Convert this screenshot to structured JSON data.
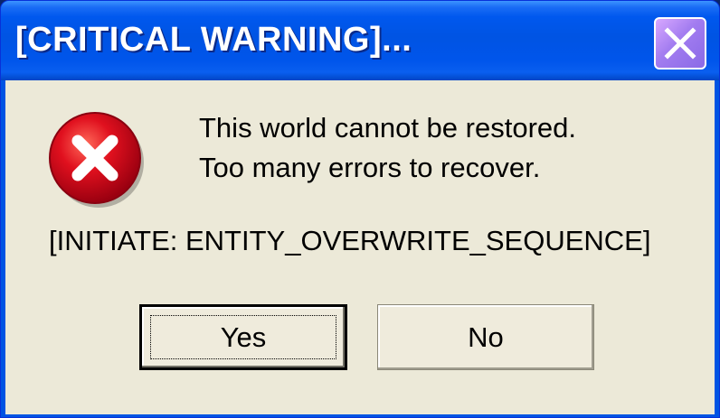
{
  "window": {
    "title": "[CRITICAL WARNING]...",
    "close_icon": "close-x-icon"
  },
  "dialog": {
    "icon": "error-icon",
    "message_line_1": "This world cannot be restored.",
    "message_line_2": "Too many errors to recover.",
    "command": "[INITIATE: ENTITY_OVERWRITE_SEQUENCE]"
  },
  "buttons": {
    "yes_label": "Yes",
    "no_label": "No"
  },
  "colors": {
    "titlebar": "#0054e3",
    "client_background": "#ece9d8",
    "close_button": "#a27cf0",
    "error_red": "#d8001a"
  }
}
